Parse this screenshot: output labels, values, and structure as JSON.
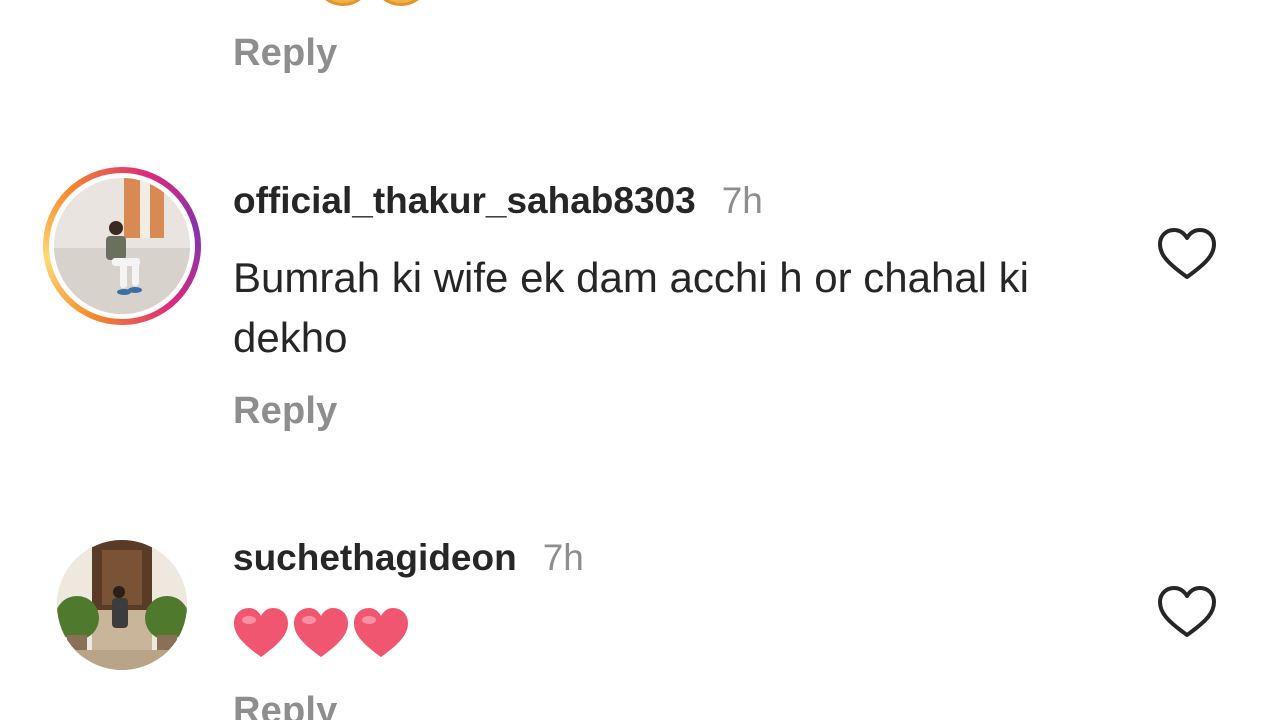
{
  "previous_comment": {
    "reply_label": "Reply"
  },
  "comments": [
    {
      "username": "official_thakur_sahab8303",
      "time": "7h",
      "text": "Bumrah ki wife ek dam acchi h or chahal ki dekho",
      "reply_label": "Reply",
      "has_story_ring": true,
      "like_icon": "heart-outline-icon"
    },
    {
      "username": "suchethagideon",
      "time": "7h",
      "text_emoji": "red-heart x3",
      "reply_label": "Reply",
      "has_story_ring": false,
      "like_icon": "heart-outline-icon"
    }
  ],
  "colors": {
    "primary_text": "#262626",
    "secondary_text": "#8e8e8e",
    "story_ring": [
      "#f58529",
      "#dd2a7b",
      "#8134af"
    ],
    "emoji_heart": "#f0566f"
  }
}
